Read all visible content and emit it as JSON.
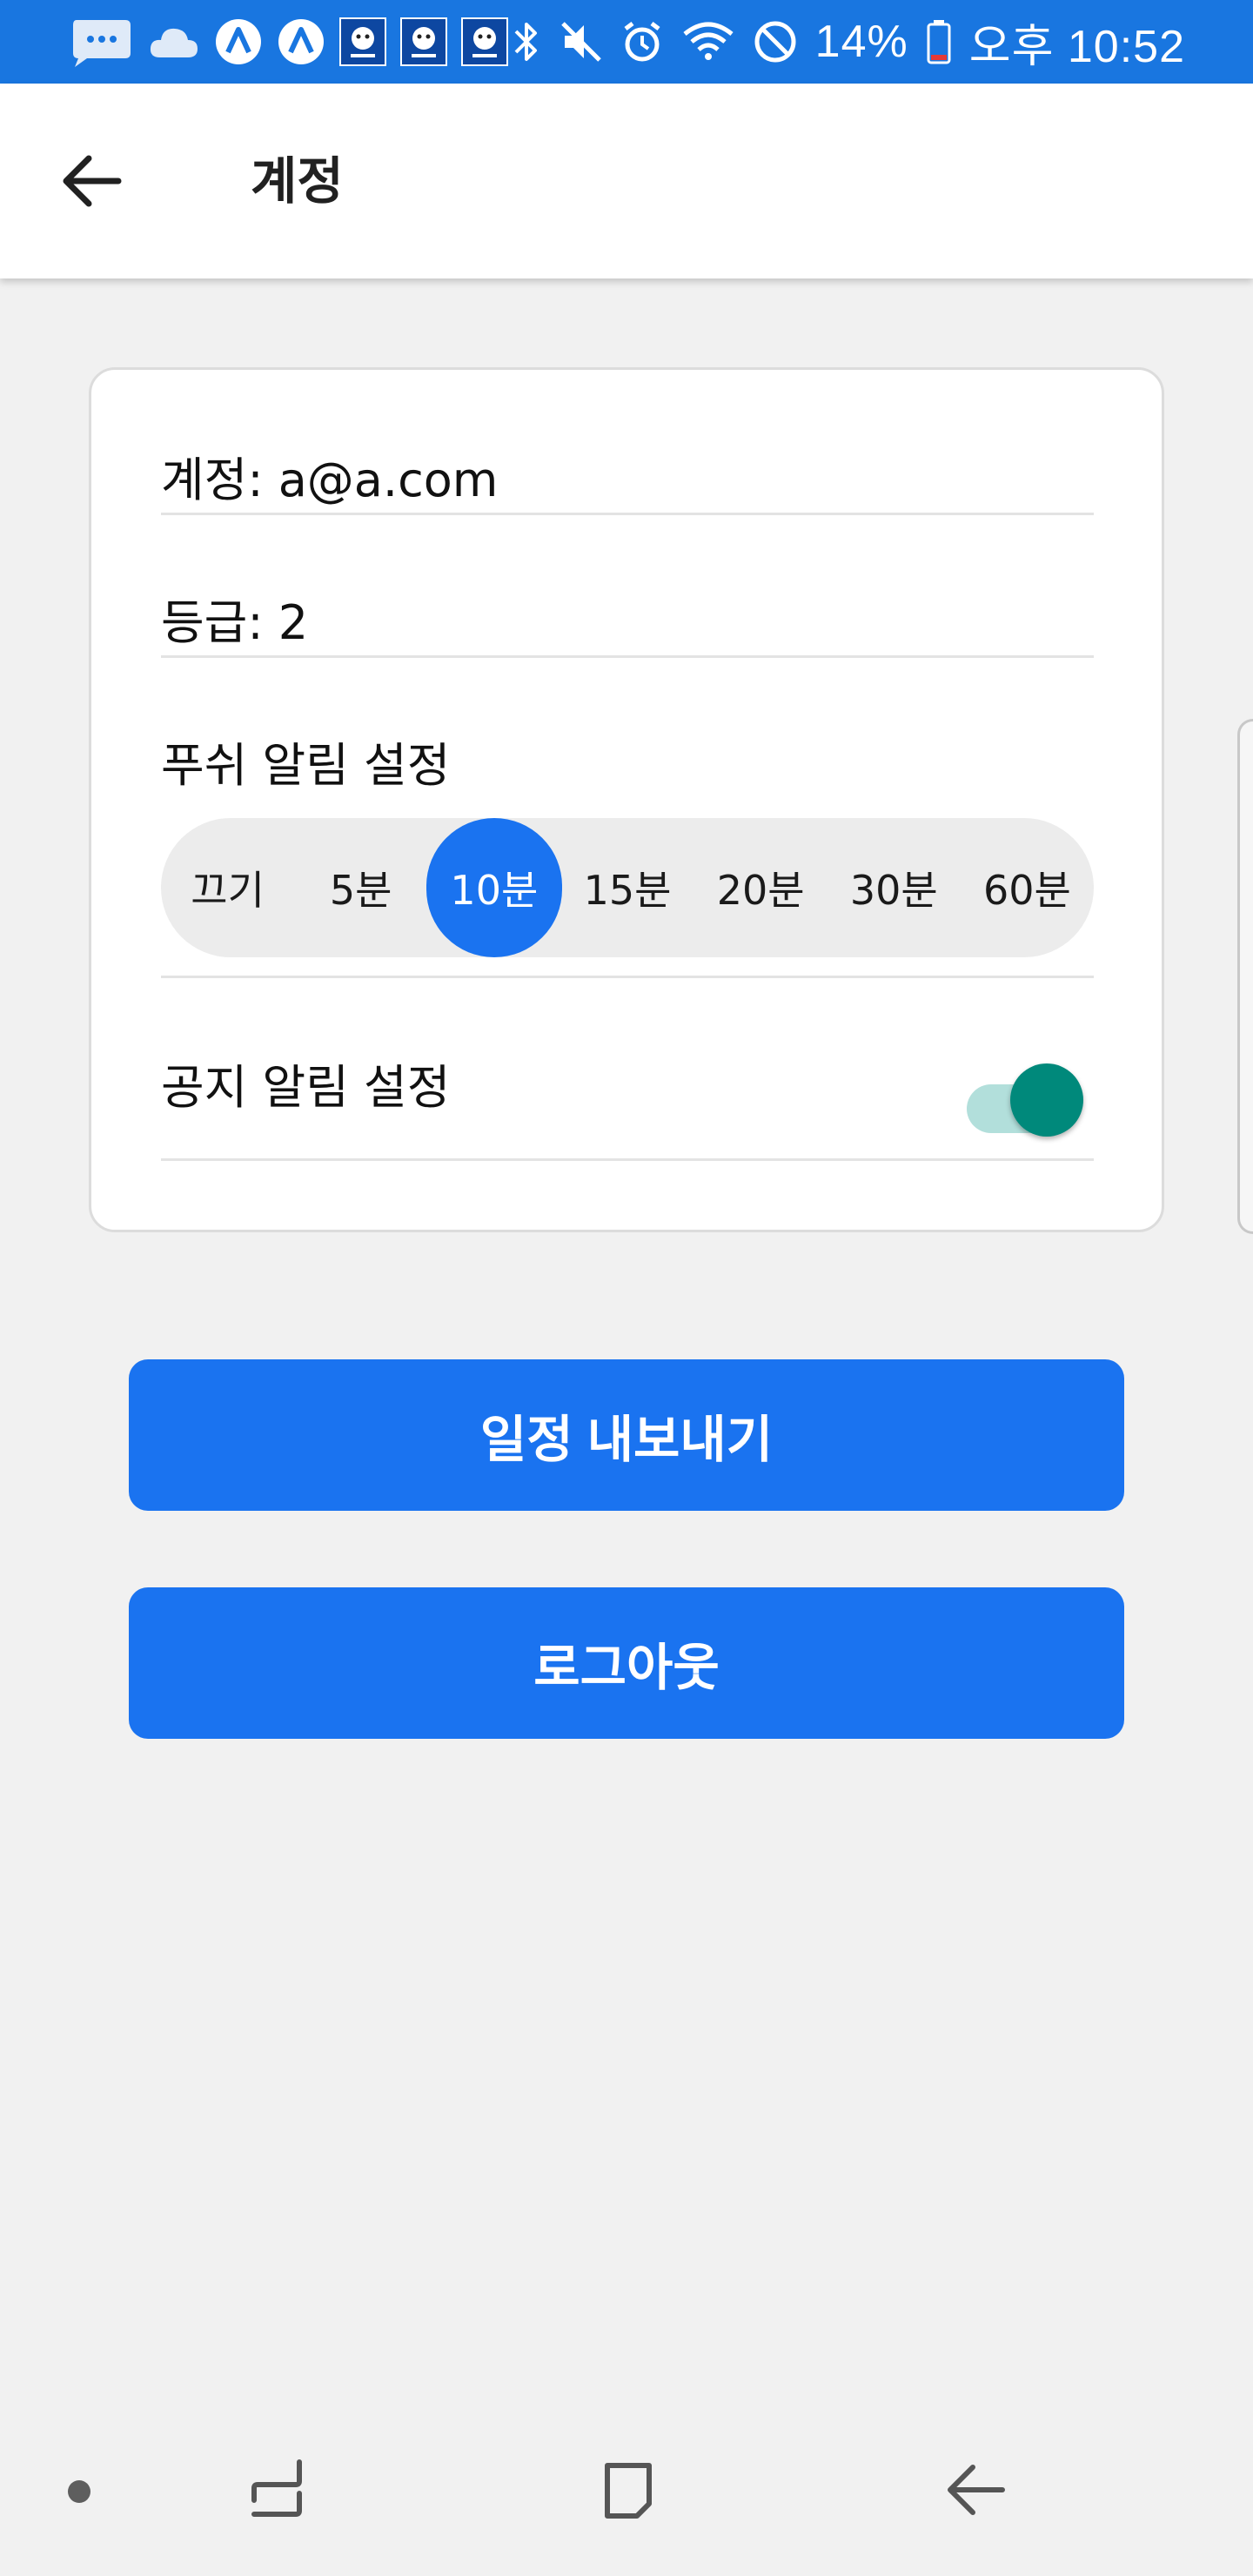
{
  "status_bar": {
    "battery_percent": "14%",
    "time": "오후 10:52",
    "left_icons": [
      "chat-bubble-icon",
      "cloud-icon",
      "app-a-icon",
      "app-a-icon",
      "app-badge-icon",
      "app-badge-icon",
      "app-badge-icon"
    ],
    "right_icons": [
      "bluetooth-icon",
      "mute-icon",
      "alarm-icon",
      "wifi-icon",
      "do-not-disturb-icon",
      "battery-icon"
    ]
  },
  "app_bar": {
    "title": "계정",
    "back_icon": "arrow-back-icon"
  },
  "account": {
    "account_label": "계정: a@a.com",
    "grade_label": "등급: 2",
    "push_title": "푸쉬 알림 설정",
    "push_options": [
      "끄기",
      "5분",
      "10분",
      "15분",
      "20분",
      "30분",
      "60분"
    ],
    "push_selected": "10분",
    "notice_title": "공지 알림 설정",
    "notice_enabled": true
  },
  "buttons": {
    "export_label": "일정 내보내기",
    "logout_label": "로그아웃"
  },
  "colors": {
    "status_bar": "#1976e0",
    "accent": "#1a73f0",
    "toggle_thumb": "#00897b",
    "toggle_track": "#b2dfdb",
    "background": "#f1f1f1"
  },
  "nav_bar": {
    "icons": [
      "dot-icon",
      "recent-apps-icon",
      "home-icon",
      "back-icon"
    ]
  }
}
